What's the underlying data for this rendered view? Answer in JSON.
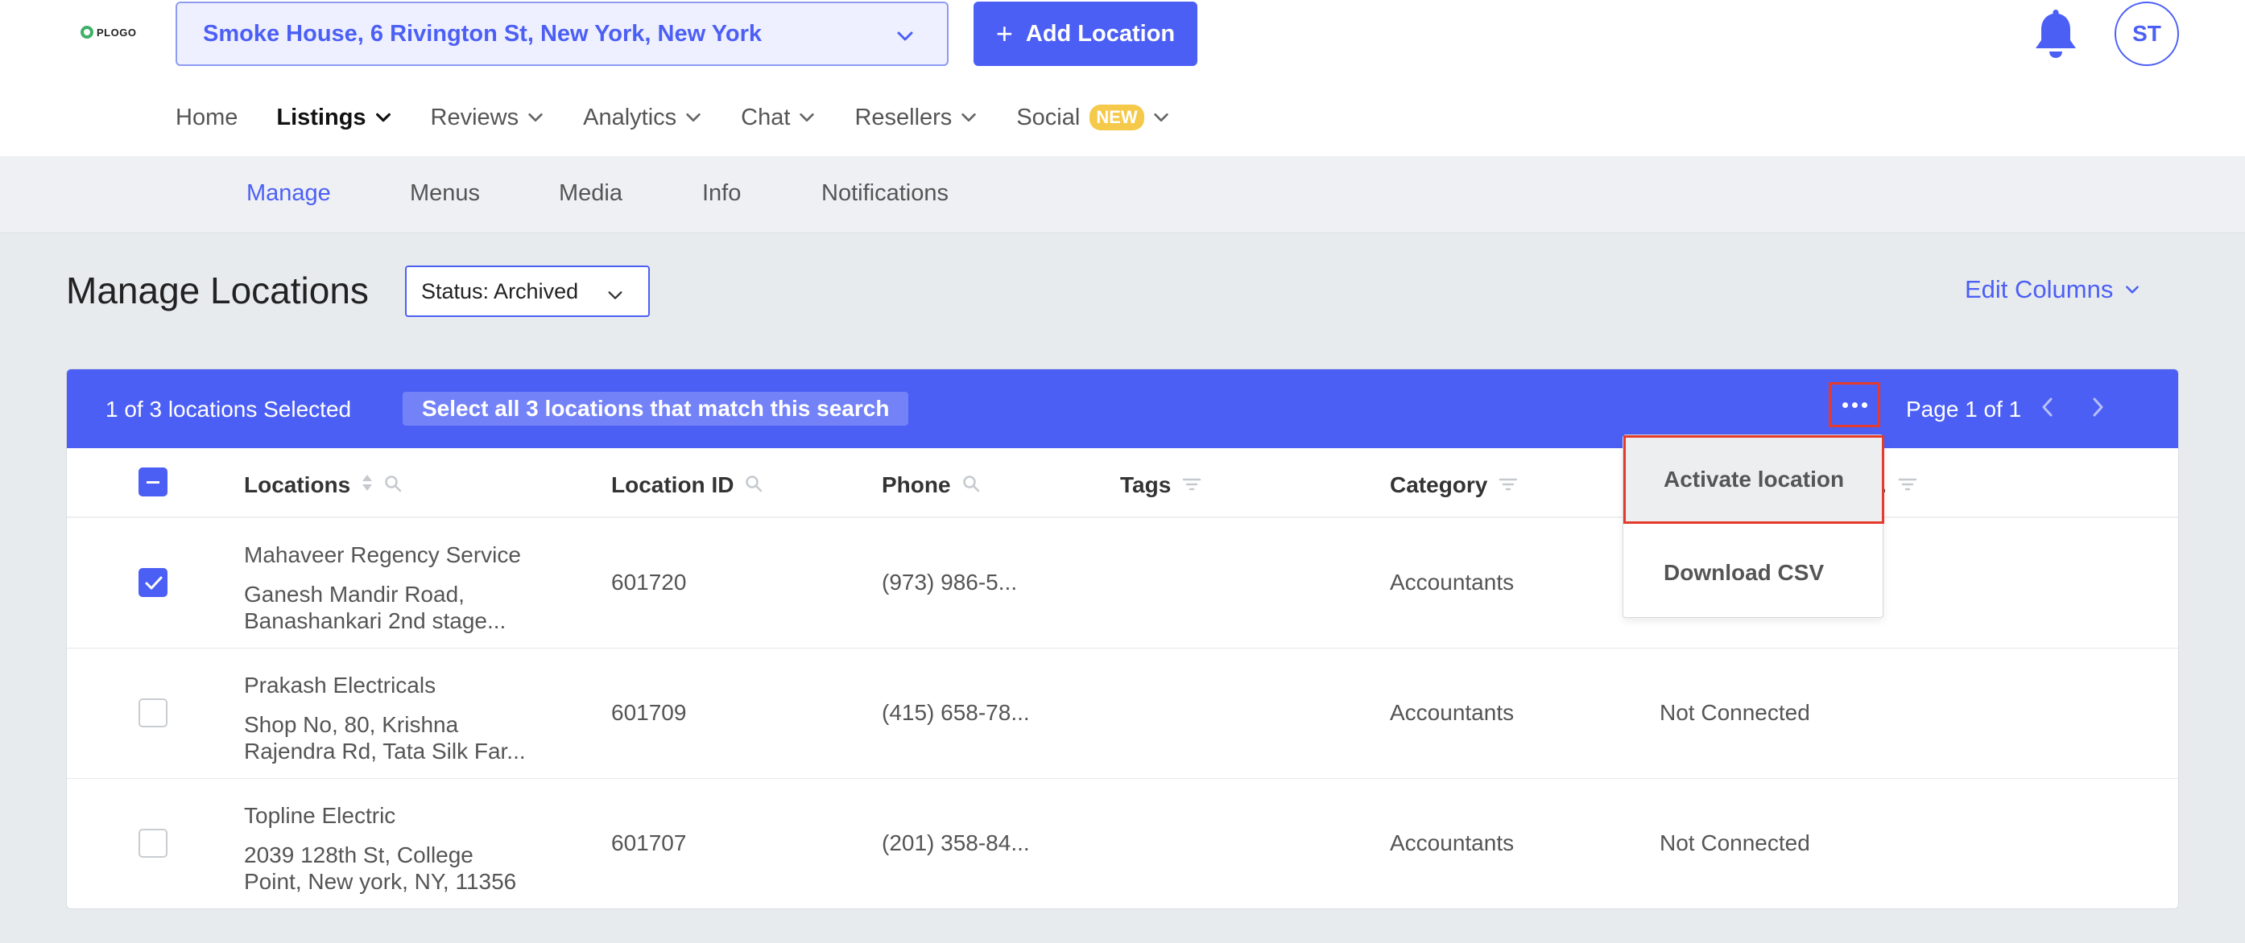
{
  "header": {
    "logo_text": "PLOGO",
    "location_select": "Smoke House, 6 Rivington St, New York, New York",
    "add_location_label": "Add Location",
    "avatar_initials": "ST"
  },
  "main_nav": {
    "items": [
      {
        "label": "Home",
        "has_dropdown": false,
        "active": false
      },
      {
        "label": "Listings",
        "has_dropdown": true,
        "active": true
      },
      {
        "label": "Reviews",
        "has_dropdown": true,
        "active": false
      },
      {
        "label": "Analytics",
        "has_dropdown": true,
        "active": false
      },
      {
        "label": "Chat",
        "has_dropdown": true,
        "active": false
      },
      {
        "label": "Resellers",
        "has_dropdown": true,
        "active": false
      },
      {
        "label": "Social",
        "has_dropdown": true,
        "active": false,
        "badge": "NEW"
      }
    ]
  },
  "sub_nav": {
    "items": [
      "Manage",
      "Menus",
      "Media",
      "Info",
      "Notifications"
    ],
    "active": "Manage"
  },
  "page": {
    "title": "Manage Locations",
    "status_filter": "Status: Archived",
    "edit_columns": "Edit Columns"
  },
  "selection_bar": {
    "count_text": "1 of 3 locations Selected",
    "select_all_text": "Select all 3 locations that match this search",
    "page_text": "Page 1 of 1"
  },
  "table": {
    "columns": [
      "Locations",
      "Location ID",
      "Phone",
      "Tags",
      "Category",
      "."
    ],
    "rows": [
      {
        "checked": true,
        "name": "Mahaveer Regency Service",
        "address": "Ganesh Mandir Road, Banashankari 2nd stage...",
        "location_id": "601720",
        "phone": "(973) 986-5...",
        "tags": "",
        "category": "Accountants",
        "status": ""
      },
      {
        "checked": false,
        "name": "Prakash Electricals",
        "address": "Shop No, 80, Krishna Rajendra Rd, Tata Silk Far...",
        "location_id": "601709",
        "phone": "(415) 658-78...",
        "tags": "",
        "category": "Accountants",
        "status": "Not Connected"
      },
      {
        "checked": false,
        "name": "Topline Electric",
        "address": "2039 128th St, College Point, New york, NY, 11356",
        "location_id": "601707",
        "phone": "(201) 358-84...",
        "tags": "",
        "category": "Accountants",
        "status": "Not Connected"
      }
    ]
  },
  "actions_menu": {
    "items": [
      "Activate location",
      "Download CSV"
    ],
    "highlighted": "Activate location"
  },
  "colors": {
    "accent": "#4c5ff5",
    "highlight_border": "#e53b2c",
    "badge": "#f5c94a",
    "logo": "#3fb068"
  },
  "icons": [
    "logo-mark-icon",
    "chevron-down-icon",
    "plus-icon",
    "bell-icon",
    "sort-icon",
    "search-icon",
    "filter-icon",
    "more-icon",
    "chevron-left-icon",
    "chevron-right-icon",
    "check-icon"
  ]
}
